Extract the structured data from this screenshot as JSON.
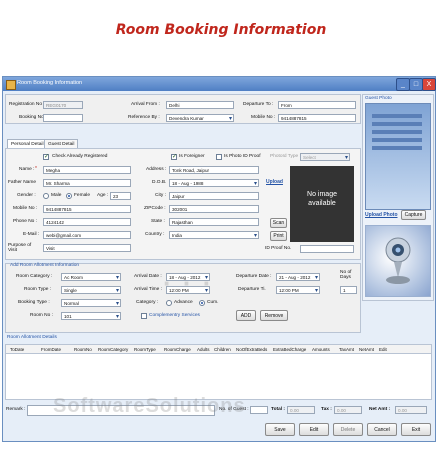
{
  "page_title": "Room Booking Information",
  "window": {
    "title": "Room Booking Information",
    "buttons": {
      "min": "_",
      "max": "□",
      "close": "X"
    }
  },
  "top": {
    "registration_no_label": "Registration No :",
    "registration_no_value": "REG0170",
    "booking_no_label": "Booking No :",
    "booking_no_value": "",
    "arrival_from_label": "Arrival From :",
    "arrival_from_value": "Delhi",
    "reference_by_label": "Reference By :",
    "reference_by_value": "Devendra Kumar",
    "departure_to_label": "Departure To :",
    "departure_to_value": "From",
    "mobile_no_label": "Mobile No :",
    "mobile_no_value": "9414887815"
  },
  "tabs": [
    "Personal Detail",
    "Guest Detail"
  ],
  "personal": {
    "check_registered": "Check Already Registered",
    "is_foreigner": "Is Foreigner",
    "is_photo_id_proof": "Is Photo ID Proof",
    "photo_id_type_label": "PhotoId Type :",
    "photo_id_type_value": "Select",
    "name_label": "Name :",
    "name_value": "Megha",
    "father_label": "Father Name",
    "father_value": "Mr. Sharma",
    "gender_label": "Gender :",
    "male": "Male",
    "female": "Female",
    "age_label": "Age :",
    "age_value": "23",
    "mobile_label": "Mobile No :",
    "mobile_value": "9414887815",
    "phone_label": "Phone No :",
    "phone_value": "4124142",
    "email_label": "E-Mail :",
    "email_value": "webi@gmail.com",
    "purpose_label": "Purpose of Visit",
    "purpose_value": "Visit",
    "address_label": "Address :",
    "address_value": "Tonk Road, Jaipur",
    "dob_label": "D.O.B.",
    "dob_value": "18 - Aug - 1988",
    "city_label": "City :",
    "city_value": "Jaipur",
    "zip_label": "ZIPCode :",
    "zip_value": "302001",
    "state_label": "State :",
    "state_value": "Rajasthan",
    "country_label": "Country :",
    "country_value": "India",
    "upload_label": "Upload",
    "no_image": "No image available",
    "scan_btn": "Scan",
    "print_btn": "Print",
    "id_proof_label": "ID Proof No."
  },
  "guest_photo": {
    "title": "Guest Photo",
    "upload_photo": "Upload Photo",
    "capture": "Capture"
  },
  "room_allot": {
    "section": "Add Room Allotment Information",
    "room_category_label": "Room Category :",
    "room_category_value": "Ac Room",
    "room_type_label": "Room Type :",
    "room_type_value": "Single",
    "booking_type_label": "Booking Type :",
    "booking_type_value": "Normal",
    "room_no_label": "Room No :",
    "room_no_value": "101",
    "arrival_date_label": "Arrival Date :",
    "arrival_date_value": "18 - Aug - 2012",
    "arrival_time_label": "Arrival Time :",
    "arrival_time_value": "12:00 PM",
    "category_label": "Category :",
    "advance": "Advance",
    "cum": "Cum.",
    "complementry": "Complementry Services",
    "departure_date_label": "Departure Date :",
    "departure_date_value": "21 - Aug - 2012",
    "departure_time_label": "Departure Ti.",
    "departure_time_value": "12:00 PM",
    "no_days_label": "No of Days",
    "no_days_value": "1",
    "add_btn": "ADD",
    "remove_btn": "Remove"
  },
  "allot_details": {
    "title": "Room Allotment Details",
    "columns": [
      "ToDate",
      "FromDate",
      "RoomNo",
      "RoomCategory",
      "RoomType",
      "RoomCharge",
      "Adults",
      "Children",
      "NoOfExtraBeds",
      "ExtraBedCharge",
      "Amounts",
      "TaxAmt",
      "NetAmt",
      "Edit"
    ]
  },
  "bottom": {
    "remark_label": "Remark :",
    "no_guest_label": "No. of Guest :",
    "total_label": "Total :",
    "total_value": "0.00",
    "tax_label": "Tax :",
    "tax_value": "0.00",
    "net_amt_label": "Net Amt :",
    "net_amt_value": "0.00",
    "save": "Save",
    "edit": "Edit",
    "delete": "Delete",
    "cancel": "Cancel",
    "exit": "Exit"
  },
  "watermark": "SoftwareSolutions",
  "colors": {
    "title_red": "#c0261c",
    "window_blue": "#4f7fc4",
    "panel_bg": "#e6eef8",
    "link_blue": "#2453a6"
  }
}
